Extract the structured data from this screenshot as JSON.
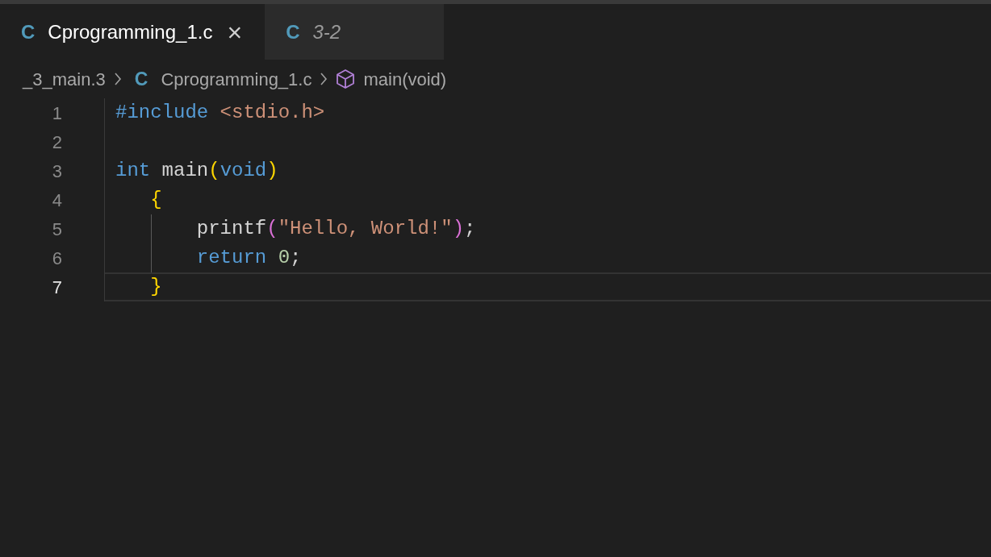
{
  "tabs": [
    {
      "icon_letter": "C",
      "label": "Cprogramming_1.c",
      "selected": true,
      "preview": false,
      "close": "×"
    },
    {
      "icon_letter": "C",
      "label": "3-2",
      "selected": false,
      "preview": true
    }
  ],
  "breadcrumbs": [
    {
      "kind": "folder",
      "label": "_3_main.3"
    },
    {
      "kind": "file",
      "icon_letter": "C",
      "label": "Cprogramming_1.c"
    },
    {
      "kind": "symbol",
      "label": "main(void)"
    }
  ],
  "lines": [
    {
      "number": "1",
      "current": false,
      "tokens": [
        {
          "kind": "keyword",
          "text": "#include"
        },
        {
          "kind": "string",
          "text": " <stdio.h>"
        }
      ]
    },
    {
      "number": "2",
      "current": false
    },
    {
      "number": "3",
      "current": false,
      "tokens": [
        {
          "kind": "keyword",
          "text": "int"
        },
        {
          "kind": "plain",
          "text": " main"
        },
        {
          "kind": "bracket1",
          "text": "("
        },
        {
          "kind": "keyword",
          "text": "void"
        },
        {
          "kind": "bracket1",
          "text": ")"
        }
      ]
    },
    {
      "number": "4",
      "current": false,
      "tokens": [
        {
          "kind": "bracket1",
          "text": "   {"
        }
      ]
    },
    {
      "number": "5",
      "current": false,
      "tokens": [
        {
          "kind": "plain",
          "text": "       printf"
        },
        {
          "kind": "bracket2",
          "text": "("
        },
        {
          "kind": "string",
          "text": "\"Hello, World!\""
        },
        {
          "kind": "bracket2",
          "text": ")"
        },
        {
          "kind": "plain",
          "text": ";"
        }
      ]
    },
    {
      "number": "6",
      "current": false,
      "tokens": [
        {
          "kind": "keyword",
          "text": "       return"
        },
        {
          "kind": "number",
          "text": " 0"
        },
        {
          "kind": "plain",
          "text": ";"
        }
      ]
    },
    {
      "number": "7",
      "current": true,
      "tokens": [
        {
          "kind": "bracket1",
          "text": "   }"
        }
      ]
    }
  ]
}
